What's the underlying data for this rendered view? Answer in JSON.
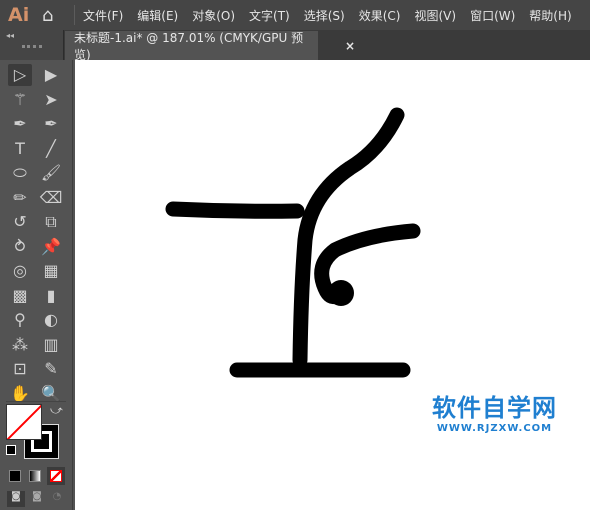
{
  "app": {
    "logo": "Ai",
    "home_icon": "home-icon"
  },
  "menu": [
    "文件(F)",
    "编辑(E)",
    "对象(O)",
    "文字(T)",
    "选择(S)",
    "效果(C)",
    "视图(V)",
    "窗口(W)",
    "帮助(H)"
  ],
  "tab": {
    "title": "未标题-1.ai* @ 187.01% (CMYK/GPU 预览)",
    "close": "×"
  },
  "panel": {
    "collapse": "◂◂"
  },
  "tools": [
    {
      "name": "selection",
      "glyph": "▷"
    },
    {
      "name": "direct-selection",
      "glyph": "▶"
    },
    {
      "name": "magic-wand",
      "glyph": "⚚"
    },
    {
      "name": "lasso",
      "glyph": "➤"
    },
    {
      "name": "pen",
      "glyph": "✒"
    },
    {
      "name": "curvature",
      "glyph": "✒"
    },
    {
      "name": "type",
      "glyph": "T"
    },
    {
      "name": "line",
      "glyph": "╱"
    },
    {
      "name": "ellipse",
      "glyph": "⬭"
    },
    {
      "name": "paintbrush",
      "glyph": "🖌"
    },
    {
      "name": "pencil",
      "glyph": "✏"
    },
    {
      "name": "eraser",
      "glyph": "⌫"
    },
    {
      "name": "rotate",
      "glyph": "↺"
    },
    {
      "name": "scale",
      "glyph": "⧉"
    },
    {
      "name": "puppet-warp",
      "glyph": "⥁"
    },
    {
      "name": "pin",
      "glyph": "📌"
    },
    {
      "name": "shape-builder",
      "glyph": "◎"
    },
    {
      "name": "perspective-grid",
      "glyph": "▦"
    },
    {
      "name": "mesh",
      "glyph": "▩"
    },
    {
      "name": "gradient",
      "glyph": "▮"
    },
    {
      "name": "eyedropper",
      "glyph": "⚲"
    },
    {
      "name": "blend",
      "glyph": "◐"
    },
    {
      "name": "symbol-sprayer",
      "glyph": "⁂"
    },
    {
      "name": "column-graph",
      "glyph": "▥"
    },
    {
      "name": "artboard",
      "glyph": "⊡"
    },
    {
      "name": "slice",
      "glyph": "✎"
    },
    {
      "name": "hand",
      "glyph": "✋"
    },
    {
      "name": "zoom",
      "glyph": "🔍"
    }
  ],
  "colors": {
    "fill": "#ffffff",
    "stroke": "#000000",
    "none_slash": "#ff0000",
    "stroke_art": "#000000",
    "watermark": "#1f7fd0"
  },
  "watermark": {
    "title": "软件自学网",
    "url": "WWW.RJZXW.COM"
  }
}
